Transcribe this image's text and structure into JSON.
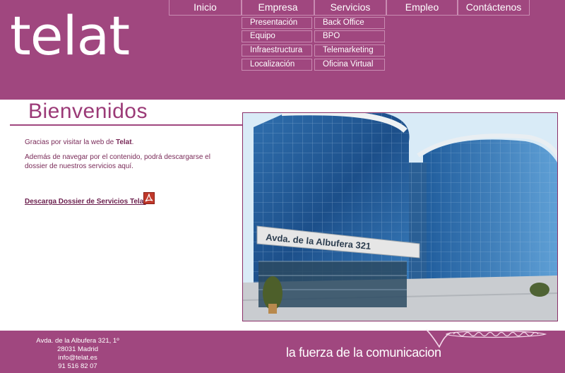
{
  "brand": {
    "logo_text": "telat"
  },
  "nav": {
    "items": [
      {
        "label": "Inicio"
      },
      {
        "label": "Empresa",
        "submenu": [
          "Presentación",
          "Equipo",
          "Infraestructura",
          "Localización"
        ]
      },
      {
        "label": "Servicios",
        "submenu": [
          "Back Office",
          "BPO",
          "Telemarketing",
          "Oficina Virtual"
        ]
      },
      {
        "label": "Empleo"
      },
      {
        "label": "Contáctenos"
      }
    ]
  },
  "main": {
    "title": "Bienvenidos",
    "intro_prefix": "Gracias por visitar la web de ",
    "intro_brand": "Telat",
    "intro_suffix": ".",
    "paragraph_line1": "Además de navegar por el contenido, podrá descargarse el",
    "paragraph_line2": "dossier de nuestros servicios aquí.",
    "download_link": "Descarga Dossier de Servicios Telat",
    "building_sign": "Avda. de la Albufera 321"
  },
  "footer": {
    "address_line1": "Avda. de la Albufera 321, 1º",
    "address_line2": "28031 Madrid",
    "email": "info@telat.es",
    "phone": "91 516 82 07",
    "slogan": "la fuerza de la comunicacion"
  },
  "colors": {
    "brand": "#a0477f",
    "title": "#9b3a77",
    "text": "#7a2b59"
  }
}
